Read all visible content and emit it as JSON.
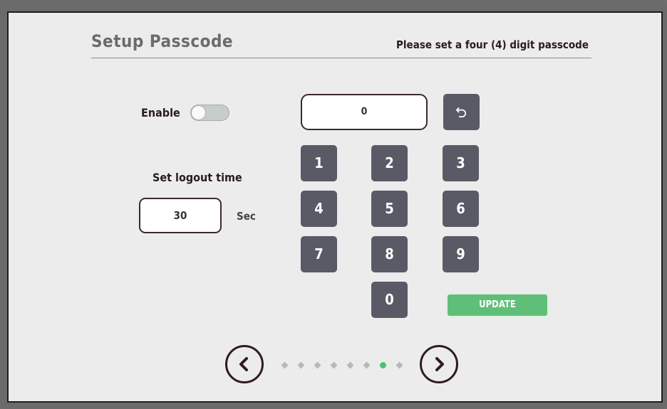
{
  "header": {
    "title": "Setup Passcode",
    "instruction": "Please set a four (4) digit passcode"
  },
  "enable": {
    "label": "Enable",
    "state": "off"
  },
  "logout": {
    "label": "Set logout time",
    "value": "30",
    "unit": "Sec"
  },
  "passcode": {
    "display_value": "0"
  },
  "keypad": {
    "keys": [
      "1",
      "2",
      "3",
      "4",
      "5",
      "6",
      "7",
      "8",
      "9",
      "0"
    ],
    "backspace_icon": "backspace-icon"
  },
  "update_button": {
    "label": "UPDATE",
    "color": "#5fbf79"
  },
  "pagination": {
    "total_pages": 8,
    "current_page": 7,
    "active_color": "#4cc277",
    "inactive_color": "#b8b8b8",
    "prev_icon": "chevron-left-icon",
    "next_icon": "chevron-right-icon"
  }
}
